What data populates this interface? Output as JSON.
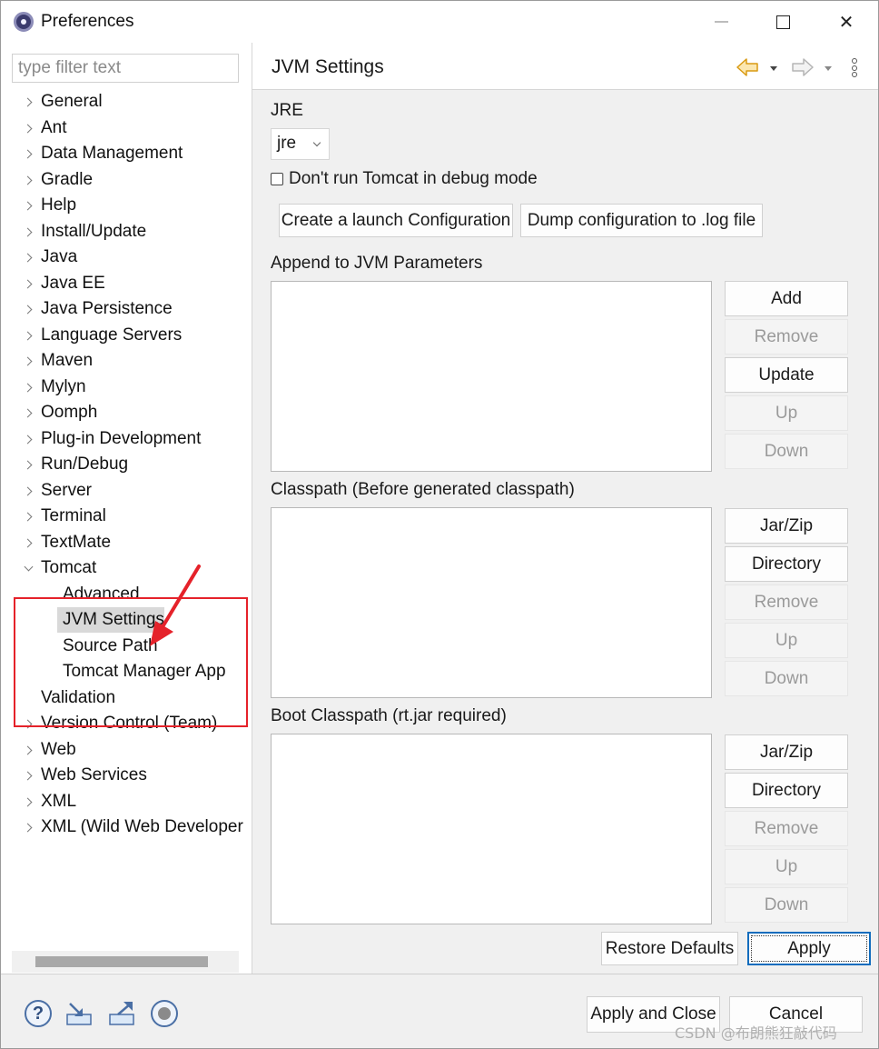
{
  "window": {
    "title": "Preferences",
    "minimize_glyph": "─",
    "close_glyph": "✕"
  },
  "filter": {
    "placeholder": "type filter text",
    "value": ""
  },
  "tree": {
    "items": [
      {
        "label": "General",
        "expandable": true
      },
      {
        "label": "Ant",
        "expandable": true
      },
      {
        "label": "Data Management",
        "expandable": true
      },
      {
        "label": "Gradle",
        "expandable": true
      },
      {
        "label": "Help",
        "expandable": true
      },
      {
        "label": "Install/Update",
        "expandable": true
      },
      {
        "label": "Java",
        "expandable": true
      },
      {
        "label": "Java EE",
        "expandable": true
      },
      {
        "label": "Java Persistence",
        "expandable": true
      },
      {
        "label": "Language Servers",
        "expandable": true
      },
      {
        "label": "Maven",
        "expandable": true
      },
      {
        "label": "Mylyn",
        "expandable": true
      },
      {
        "label": "Oomph",
        "expandable": true
      },
      {
        "label": "Plug-in Development",
        "expandable": true
      },
      {
        "label": "Run/Debug",
        "expandable": true
      },
      {
        "label": "Server",
        "expandable": true
      },
      {
        "label": "Terminal",
        "expandable": true
      },
      {
        "label": "TextMate",
        "expandable": true
      },
      {
        "label": "Tomcat",
        "expandable": true,
        "expanded": true
      },
      {
        "label": "Advanced",
        "child": true
      },
      {
        "label": "JVM Settings",
        "child": true,
        "selected": true
      },
      {
        "label": "Source Path",
        "child": true
      },
      {
        "label": "Tomcat Manager App",
        "child": true
      },
      {
        "label": "Validation",
        "expandable": false
      },
      {
        "label": "Version Control (Team)",
        "expandable": true
      },
      {
        "label": "Web",
        "expandable": true
      },
      {
        "label": "Web Services",
        "expandable": true
      },
      {
        "label": "XML",
        "expandable": true
      },
      {
        "label": "XML (Wild Web Developer",
        "expandable": true
      }
    ]
  },
  "page": {
    "title": "JVM Settings",
    "jre_label": "JRE",
    "jre_value": "jre",
    "debug_checkbox_label": "Don't run Tomcat in debug mode",
    "debug_checked": false,
    "create_launch_button": "Create a launch Configuration",
    "dump_config_button": "Dump configuration to .log file",
    "jvm_params": {
      "label": "Append to JVM Parameters",
      "buttons": [
        {
          "label": "Add",
          "enabled": true
        },
        {
          "label": "Remove",
          "enabled": false
        },
        {
          "label": "Update",
          "enabled": true
        },
        {
          "label": "Up",
          "enabled": false
        },
        {
          "label": "Down",
          "enabled": false
        }
      ]
    },
    "classpath": {
      "label": "Classpath (Before generated classpath)",
      "buttons": [
        {
          "label": "Jar/Zip",
          "enabled": true
        },
        {
          "label": "Directory",
          "enabled": true
        },
        {
          "label": "Remove",
          "enabled": false
        },
        {
          "label": "Up",
          "enabled": false
        },
        {
          "label": "Down",
          "enabled": false
        }
      ]
    },
    "boot_classpath": {
      "label": "Boot Classpath (rt.jar required)",
      "buttons": [
        {
          "label": "Jar/Zip",
          "enabled": true
        },
        {
          "label": "Directory",
          "enabled": true
        },
        {
          "label": "Remove",
          "enabled": false
        },
        {
          "label": "Up",
          "enabled": false
        },
        {
          "label": "Down",
          "enabled": false
        }
      ]
    },
    "restore_defaults_button": "Restore Defaults",
    "apply_button": "Apply"
  },
  "footer": {
    "apply_close_button": "Apply and Close",
    "cancel_button": "Cancel",
    "help_glyph": "?"
  },
  "watermark": "CSDN @布朗熊狂敲代码",
  "colors": {
    "annotation_red": "#e5222a",
    "default_button_border": "#0f6cbd",
    "back_arrow": "#e8a317"
  }
}
